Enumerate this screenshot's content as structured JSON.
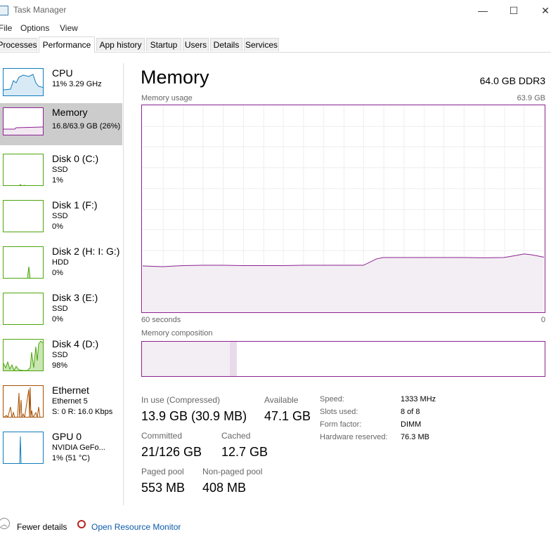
{
  "window": {
    "title": "Task Manager",
    "minimize": "—",
    "maximize": "☐",
    "close": "✕"
  },
  "menu": [
    "File",
    "Options",
    "View"
  ],
  "tabs": [
    "Processes",
    "Performance",
    "App history",
    "Startup",
    "Users",
    "Details",
    "Services"
  ],
  "active_tab": "Performance",
  "sidebar": [
    {
      "name": "CPU",
      "sub1": "11% 3.29 GHz",
      "sub2": "",
      "color": "#117dbb",
      "fill": "#f1f6fa"
    },
    {
      "name": "Memory",
      "sub1": "16.8/63.9 GB (26%)",
      "sub2": "",
      "color": "#8b2291",
      "fill": "#f4f2f4"
    },
    {
      "name": "Disk 0 (C:)",
      "sub1": "SSD",
      "sub2": "1%",
      "color": "#4da60c",
      "fill": "#eff7ea"
    },
    {
      "name": "Disk 1 (F:)",
      "sub1": "SSD",
      "sub2": "0%",
      "color": "#4da60c",
      "fill": "#eff7ea"
    },
    {
      "name": "Disk 2 (H: I: G:)",
      "sub1": "HDD",
      "sub2": "0%",
      "color": "#4da60c",
      "fill": "#eff7ea"
    },
    {
      "name": "Disk 3 (E:)",
      "sub1": "SSD",
      "sub2": "0%",
      "color": "#4da60c",
      "fill": "#eff7ea"
    },
    {
      "name": "Disk 4 (D:)",
      "sub1": "SSD",
      "sub2": "98%",
      "color": "#4da60c",
      "fill": "#eff7ea"
    },
    {
      "name": "Ethernet",
      "sub1": "Ethernet 5",
      "sub2": "S: 0  R: 16.0 Kbps",
      "color": "#a74f01",
      "fill": "#fcf3eb"
    },
    {
      "name": "GPU 0",
      "sub1": "NVIDIA GeFo...",
      "sub2": "1% (51 °C)",
      "color": "#117dbb",
      "fill": "#f1f6fa"
    }
  ],
  "main": {
    "title": "Memory",
    "spec": "64.0 GB DDR3",
    "usage_label": "Memory usage",
    "usage_max": "63.9 GB",
    "time_left": "60 seconds",
    "time_right": "0",
    "composition_label": "Memory composition"
  },
  "stats": {
    "in_use_label": "In use (Compressed)",
    "in_use_value": "13.9 GB (30.9 MB)",
    "available_label": "Available",
    "available_value": "47.1 GB",
    "committed_label": "Committed",
    "committed_value": "21/126 GB",
    "cached_label": "Cached",
    "cached_value": "12.7 GB",
    "paged_label": "Paged pool",
    "paged_value": "553 MB",
    "nonpaged_label": "Non-paged pool",
    "nonpaged_value": "408 MB"
  },
  "specs": [
    {
      "label": "Speed:",
      "value": "1333 MHz"
    },
    {
      "label": "Slots used:",
      "value": "8 of 8"
    },
    {
      "label": "Form factor:",
      "value": "DIMM"
    },
    {
      "label": "Hardware reserved:",
      "value": "76.3 MB"
    }
  ],
  "composition": {
    "in_use": 13.9,
    "modified": 1.2,
    "standby": 4.4,
    "free": 42.7,
    "total": 63.9
  },
  "chart_data": {
    "type": "area",
    "title": "Memory usage",
    "xlabel": "60 seconds",
    "ylim": [
      0,
      63.9
    ],
    "x": [
      60,
      57,
      54,
      51,
      48,
      45,
      42,
      39,
      36,
      33,
      30,
      27,
      25,
      24,
      21,
      18,
      15,
      12,
      9,
      6,
      4,
      3,
      2,
      1,
      0
    ],
    "values": [
      14.3,
      14.1,
      14.4,
      14.5,
      14.5,
      14.4,
      14.4,
      14.4,
      14.5,
      14.5,
      14.5,
      14.5,
      16.5,
      16.9,
      16.9,
      16.9,
      16.9,
      16.9,
      16.8,
      16.9,
      17.6,
      18.0,
      17.8,
      17.4,
      17.0
    ],
    "color": "#8b2291"
  },
  "footer": {
    "fewer": "Fewer details",
    "resource_monitor": "Open Resource Monitor"
  }
}
